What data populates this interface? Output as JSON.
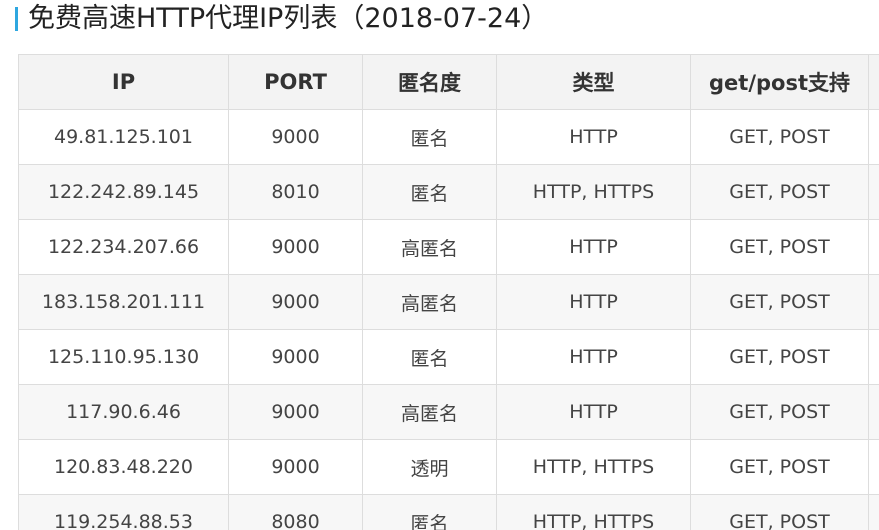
{
  "header": {
    "title": "免费高速HTTP代理IP列表（2018-07-24）"
  },
  "table": {
    "columns": [
      "IP",
      "PORT",
      "匿名度",
      "类型",
      "get/post支持"
    ],
    "rows": [
      {
        "ip": "49.81.125.101",
        "port": "9000",
        "anonymity": "匿名",
        "type": "HTTP",
        "method": "GET, POST"
      },
      {
        "ip": "122.242.89.145",
        "port": "8010",
        "anonymity": "匿名",
        "type": "HTTP, HTTPS",
        "method": "GET, POST"
      },
      {
        "ip": "122.234.207.66",
        "port": "9000",
        "anonymity": "高匿名",
        "type": "HTTP",
        "method": "GET, POST"
      },
      {
        "ip": "183.158.201.111",
        "port": "9000",
        "anonymity": "高匿名",
        "type": "HTTP",
        "method": "GET, POST"
      },
      {
        "ip": "125.110.95.130",
        "port": "9000",
        "anonymity": "匿名",
        "type": "HTTP",
        "method": "GET, POST"
      },
      {
        "ip": "117.90.6.46",
        "port": "9000",
        "anonymity": "高匿名",
        "type": "HTTP",
        "method": "GET, POST"
      },
      {
        "ip": "120.83.48.220",
        "port": "9000",
        "anonymity": "透明",
        "type": "HTTP, HTTPS",
        "method": "GET, POST"
      },
      {
        "ip": "119.254.88.53",
        "port": "8080",
        "anonymity": "匿名",
        "type": "HTTP, HTTPS",
        "method": "GET, POST"
      }
    ]
  },
  "colors": {
    "accent": "#2ea7e0",
    "header_bg": "#f3f3f3",
    "stripe_bg": "#f7f7f7",
    "border": "#dddddd"
  }
}
